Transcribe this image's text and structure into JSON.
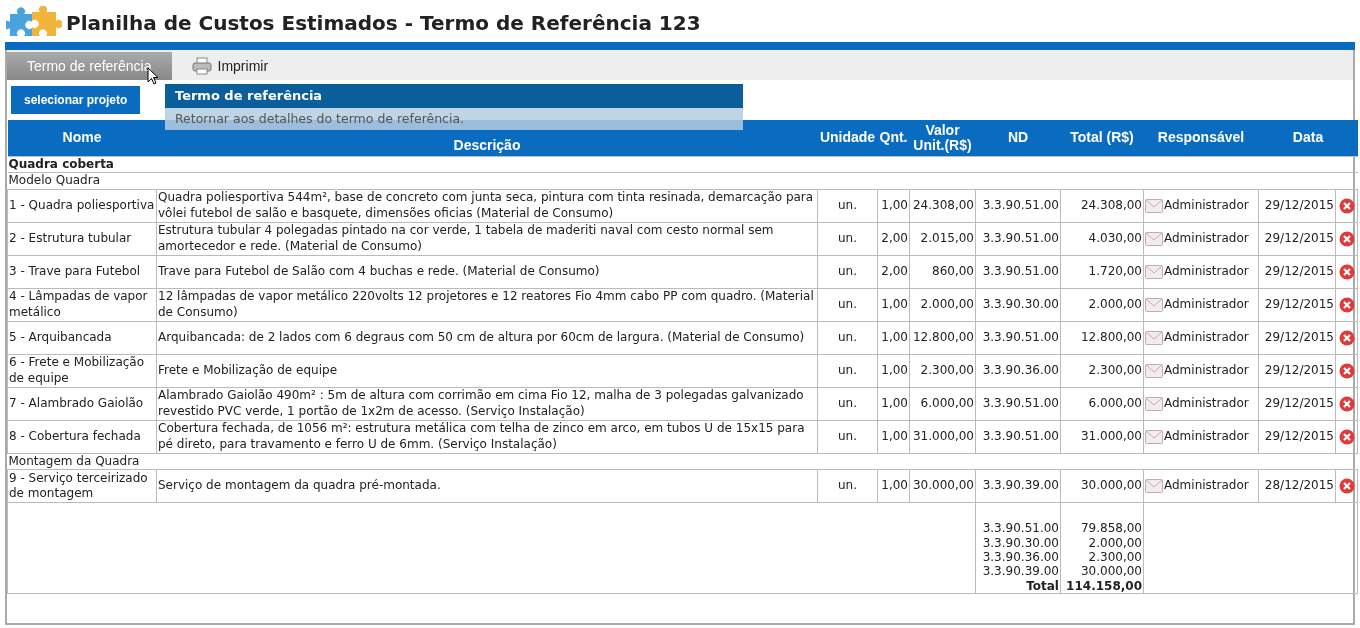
{
  "title": "Planilha de Custos Estimados - Termo de Referência 123",
  "tabs": [
    {
      "label": "Termo de referência",
      "selected": true,
      "kind": "text"
    },
    {
      "label": "Imprimir",
      "selected": false,
      "kind": "print"
    }
  ],
  "select_button": "selecionar projeto",
  "tooltip": {
    "title": "Termo de referência",
    "text": "Retornar aos detalhes do termo de referência."
  },
  "columns": [
    "Nome",
    "Descrição",
    "Unidade",
    "Qnt.",
    "Valor Unit.(R$)",
    "ND",
    "Total (R$)",
    "Responsável",
    "Data"
  ],
  "rows": [
    {
      "kind": "heading",
      "label": "Quadra coberta"
    },
    {
      "kind": "subheading",
      "label": "Modelo Quadra"
    },
    {
      "kind": "item",
      "nome": "1 - Quadra poliesportiva",
      "descricao": "Quadra poliesportiva 544m², base de concreto com junta seca, pintura com tinta resinada, demarcação para vôlei futebol de salão e basquete, dimensões oficias (Material de Consumo)",
      "unidade": "un.",
      "qnt": "1,00",
      "valor": "24.308,00",
      "nd": "3.3.90.51.00",
      "total": "24.308,00",
      "responsavel": "Administrador",
      "data": "29/12/2015"
    },
    {
      "kind": "item",
      "nome": "2 - Estrutura tubular",
      "descricao": "Estrutura tubular 4 polegadas pintado na cor verde, 1 tabela de maderiti naval com cesto normal sem amortecedor e rede. (Material de Consumo)",
      "unidade": "un.",
      "qnt": "2,00",
      "valor": "2.015,00",
      "nd": "3.3.90.51.00",
      "total": "4.030,00",
      "responsavel": "Administrador",
      "data": "29/12/2015"
    },
    {
      "kind": "item",
      "nome": "3 - Trave para Futebol",
      "descricao": "Trave para Futebol de Salão com 4 buchas e rede. (Material de Consumo)",
      "unidade": "un.",
      "qnt": "2,00",
      "valor": "860,00",
      "nd": "3.3.90.51.00",
      "total": "1.720,00",
      "responsavel": "Administrador",
      "data": "29/12/2015"
    },
    {
      "kind": "item",
      "nome": "4 - Lâmpadas de vapor metálico",
      "descricao": "12 lâmpadas de vapor metálico 220volts 12 projetores e 12 reatores Fio 4mm cabo PP com quadro. (Material de Consumo)",
      "unidade": "un.",
      "qnt": "1,00",
      "valor": "2.000,00",
      "nd": "3.3.90.30.00",
      "total": "2.000,00",
      "responsavel": "Administrador",
      "data": "29/12/2015"
    },
    {
      "kind": "item",
      "nome": "5 - Arquibancada",
      "descricao": "Arquibancada: de 2 lados com 6 degraus com 50 cm de altura por 60cm de largura. (Material de Consumo)",
      "unidade": "un.",
      "qnt": "1,00",
      "valor": "12.800,00",
      "nd": "3.3.90.51.00",
      "total": "12.800,00",
      "responsavel": "Administrador",
      "data": "29/12/2015"
    },
    {
      "kind": "item",
      "nome": "6 - Frete e Mobilização de equipe",
      "descricao": "Frete e Mobilização de equipe",
      "unidade": "un.",
      "qnt": "1,00",
      "valor": "2.300,00",
      "nd": "3.3.90.36.00",
      "total": "2.300,00",
      "responsavel": "Administrador",
      "data": "29/12/2015"
    },
    {
      "kind": "item",
      "nome": "7 - Alambrado Gaiolão",
      "descricao": "Alambrado Gaiolão 490m² : 5m de altura com corrimão em cima Fio 12, malha de 3 polegadas galvanizado revestido PVC verde, 1 portão de 1x2m de acesso. (Serviço Instalação)",
      "unidade": "un.",
      "qnt": "1,00",
      "valor": "6.000,00",
      "nd": "3.3.90.51.00",
      "total": "6.000,00",
      "responsavel": "Administrador",
      "data": "29/12/2015"
    },
    {
      "kind": "item",
      "nome": "8 - Cobertura fechada",
      "descricao": "Cobertura fechada, de 1056 m²: estrutura metálica com telha de zinco em arco, em tubos U de 15x15 para pé direto, para travamento e ferro U de 6mm. (Serviço Instalação)",
      "unidade": "un.",
      "qnt": "1,00",
      "valor": "31.000,00",
      "nd": "3.3.90.51.00",
      "total": "31.000,00",
      "responsavel": "Administrador",
      "data": "29/12/2015"
    },
    {
      "kind": "subheading",
      "label": "Montagem da Quadra"
    },
    {
      "kind": "item",
      "nome": "9 - Serviço terceirizado de montagem",
      "descricao": "Serviço de montagem da quadra pré-montada.",
      "unidade": "un.",
      "qnt": "1,00",
      "valor": "30.000,00",
      "nd": "3.3.90.39.00",
      "total": "30.000,00",
      "responsavel": "Administrador",
      "data": "28/12/2015"
    }
  ],
  "summary": [
    {
      "nd": "3.3.90.51.00",
      "total": "79.858,00"
    },
    {
      "nd": "3.3.90.30.00",
      "total": "2.000,00"
    },
    {
      "nd": "3.3.90.36.00",
      "total": "2.300,00"
    },
    {
      "nd": "3.3.90.39.00",
      "total": "30.000,00"
    }
  ],
  "grand_total": {
    "label": "Total",
    "value": "114.158,00"
  }
}
